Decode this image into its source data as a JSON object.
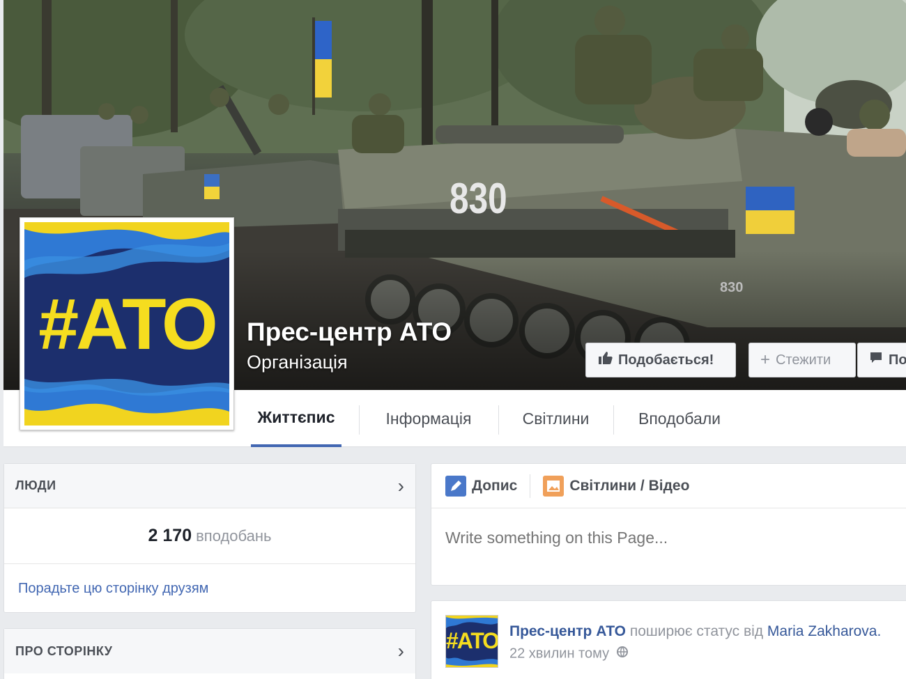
{
  "cover": {
    "page_name": "Прес-центр АТО",
    "category": "Організація",
    "vehicle_number": "830",
    "small_number": "830",
    "buttons": {
      "like": "Подобається!",
      "follow": "Стежити",
      "message": "По"
    }
  },
  "profile": {
    "hashtag": "#АТО"
  },
  "tabs": [
    {
      "label": "Життєпис",
      "active": true
    },
    {
      "label": "Інформація",
      "active": false
    },
    {
      "label": "Світлини",
      "active": false
    },
    {
      "label": "Вподобали",
      "active": false
    }
  ],
  "people_card": {
    "title": "ЛЮДИ",
    "likes_count": "2 170",
    "likes_label": "вподобань",
    "invite_text": "Порадьте цю сторінку друзям"
  },
  "about_card": {
    "title": "ПРО СТОРІНКУ"
  },
  "composer": {
    "tab_post": "Допис",
    "tab_media": "Світлини / Відео",
    "placeholder": "Write something on this Page..."
  },
  "post": {
    "avatar_text": "#АТО",
    "author": "Прес-центр АТО",
    "verb": "поширює статус від",
    "target": "Maria Zakharova.",
    "time": "22 хвилин тому"
  },
  "colors": {
    "accent": "#4267b2",
    "link": "#365899",
    "brand_blue": "#1b2e6b",
    "brand_yellow": "#f5dd1f"
  }
}
